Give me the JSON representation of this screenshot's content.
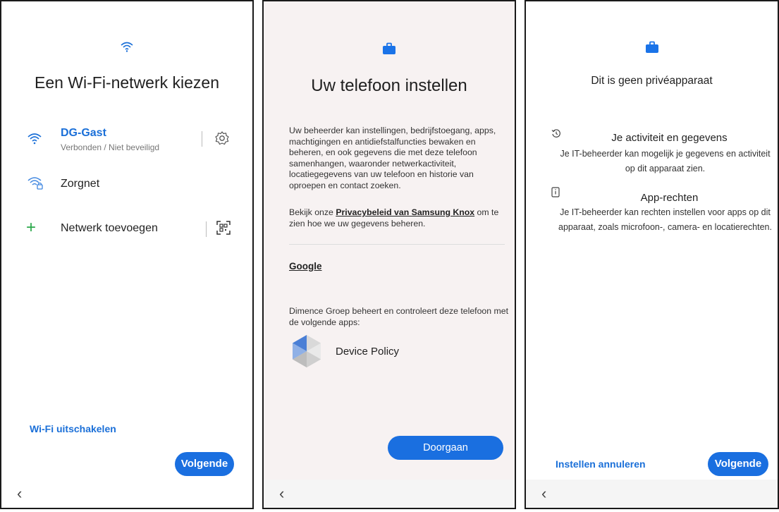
{
  "wifi_screen": {
    "title": "Een Wi-Fi-netwerk kiezen",
    "networks": [
      {
        "name": "DG-Gast",
        "status": "Verbonden / Niet beveiligd"
      },
      {
        "name": "Zorgnet"
      }
    ],
    "add_network": "Netwerk toevoegen",
    "disable_wifi": "Wi-Fi uitschakelen",
    "next_button": "Volgende",
    "icons": [
      "wifi-icon",
      "gear-icon",
      "wifi-lock-icon",
      "plus-icon",
      "qr-scan-icon",
      "back-icon"
    ],
    "accent_color": "#1a6fd8"
  },
  "setup_screen": {
    "title": "Uw telefoon instellen",
    "paragraph1": "Uw beheerder kan instellingen, bedrijfstoegang, apps, machtigingen en antidiefstalfuncties bewaken en beheren, en ook gegevens die met deze telefoon samenhangen, waaronder netwerkactiviteit, locatiegegevens van uw telefoon en historie van oproepen en contact zoeken.",
    "privacy_prefix": "Bekijk onze ",
    "privacy_link": "Privacybeleid van Samsung Knox",
    "privacy_suffix": " om te zien hoe we uw gegevens beheren.",
    "google_heading": "Google",
    "managed_text": "Dimence Groep beheert en controleert deze telefoon met de volgende apps:",
    "app_name": "Device Policy",
    "continue_button": "Doorgaan",
    "icons": [
      "briefcase-icon",
      "device-policy-icon",
      "back-icon"
    ]
  },
  "privacy_screen": {
    "title": "Dit is geen privéapparaat",
    "sections": [
      {
        "title": "Je activiteit en gegevens",
        "body": "Je IT-beheerder kan mogelijk je gegevens en activiteit op dit apparaat zien.",
        "icon": "history-icon"
      },
      {
        "title": "App-rechten",
        "body": "Je IT-beheerder kan rechten instellen voor apps op dit apparaat, zoals microfoon-, camera- en locatierechten.",
        "icon": "phone-info-icon"
      }
    ],
    "cancel_link": "Instellen annuleren",
    "next_button": "Volgende",
    "icons": [
      "briefcase-icon",
      "back-icon"
    ]
  }
}
